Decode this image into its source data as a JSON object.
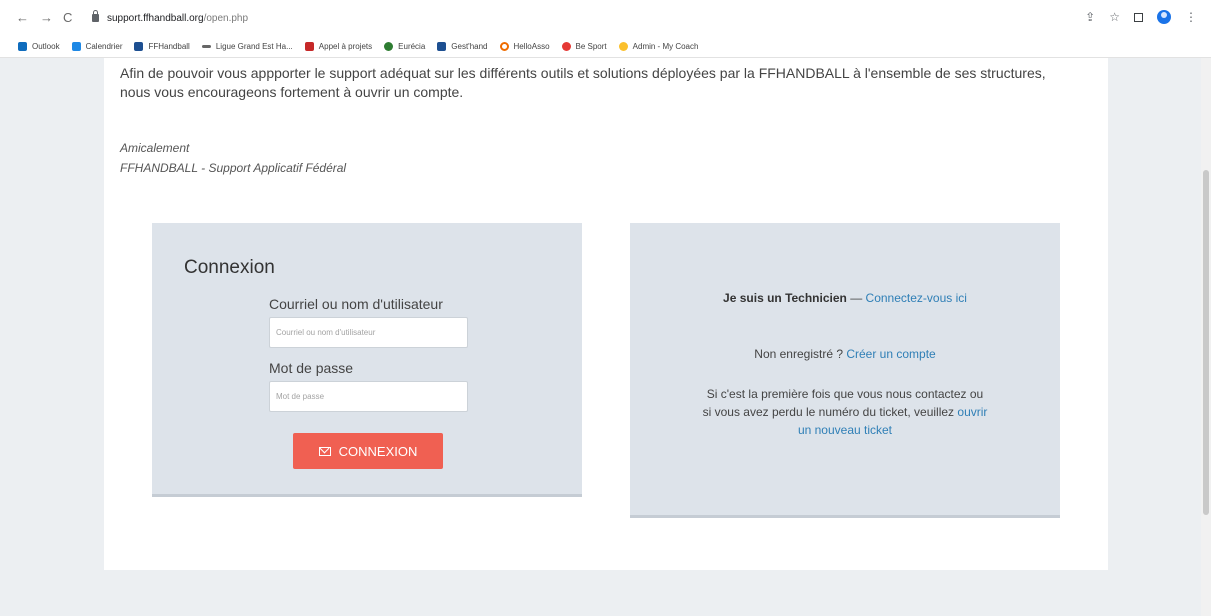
{
  "browser": {
    "back": "←",
    "forward": "→",
    "reload": "C",
    "url_host": "support.ffhandball.org",
    "url_path": "/open.php",
    "share": "⇪",
    "star": "☆",
    "menu": "⋮"
  },
  "bookmarks": [
    {
      "label": "Outlook",
      "color": "#0f6cbd"
    },
    {
      "label": "Calendrier",
      "color": "#1e88e5"
    },
    {
      "label": "FFHandball",
      "color": "#1d4f91"
    },
    {
      "label": "Ligue Grand Est Ha...",
      "color": "#666666"
    },
    {
      "label": "Appel à projets",
      "color": "#c62828"
    },
    {
      "label": "Eurécia",
      "color": "#2e7d32"
    },
    {
      "label": "Gest'hand",
      "color": "#1d4f91"
    },
    {
      "label": "HelloAsso",
      "color": "#ef6c00"
    },
    {
      "label": "Be Sport",
      "color": "#e53935"
    },
    {
      "label": "Admin - My Coach",
      "color": "#fbc02d"
    }
  ],
  "intro": {
    "text": "Afin de pouvoir vous appporter le support adéquat sur les différents outils et solutions déployées par la FFHANDBALL à l'ensemble de ses structures, nous vous encourageons fortement à ouvrir un compte.",
    "sign_line1": "Amicalement",
    "sign_line2": "FFHANDBALL - Support Applicatif Fédéral"
  },
  "login": {
    "title": "Connexion",
    "user_label": "Courriel ou nom d'utilisateur",
    "user_placeholder": "Courriel ou nom d'utilisateur",
    "pass_label": "Mot de passe",
    "pass_placeholder": "Mot de passe",
    "button": "CONNEXION"
  },
  "info": {
    "tech_bold": "Je suis un Technicien",
    "tech_sep": " — ",
    "tech_link": "Connectez-vous ici",
    "unreg_text": "Non enregistré ? ",
    "unreg_link": "Créer un compte",
    "first_text": "Si c'est la première fois que vous nous contactez ou si vous avez perdu le numéro du ticket, veuillez ",
    "first_link": "ouvrir un nouveau ticket"
  },
  "colors": {
    "accent_button": "#f06052",
    "link": "#2f7fb6",
    "panel": "#dde3ea"
  }
}
